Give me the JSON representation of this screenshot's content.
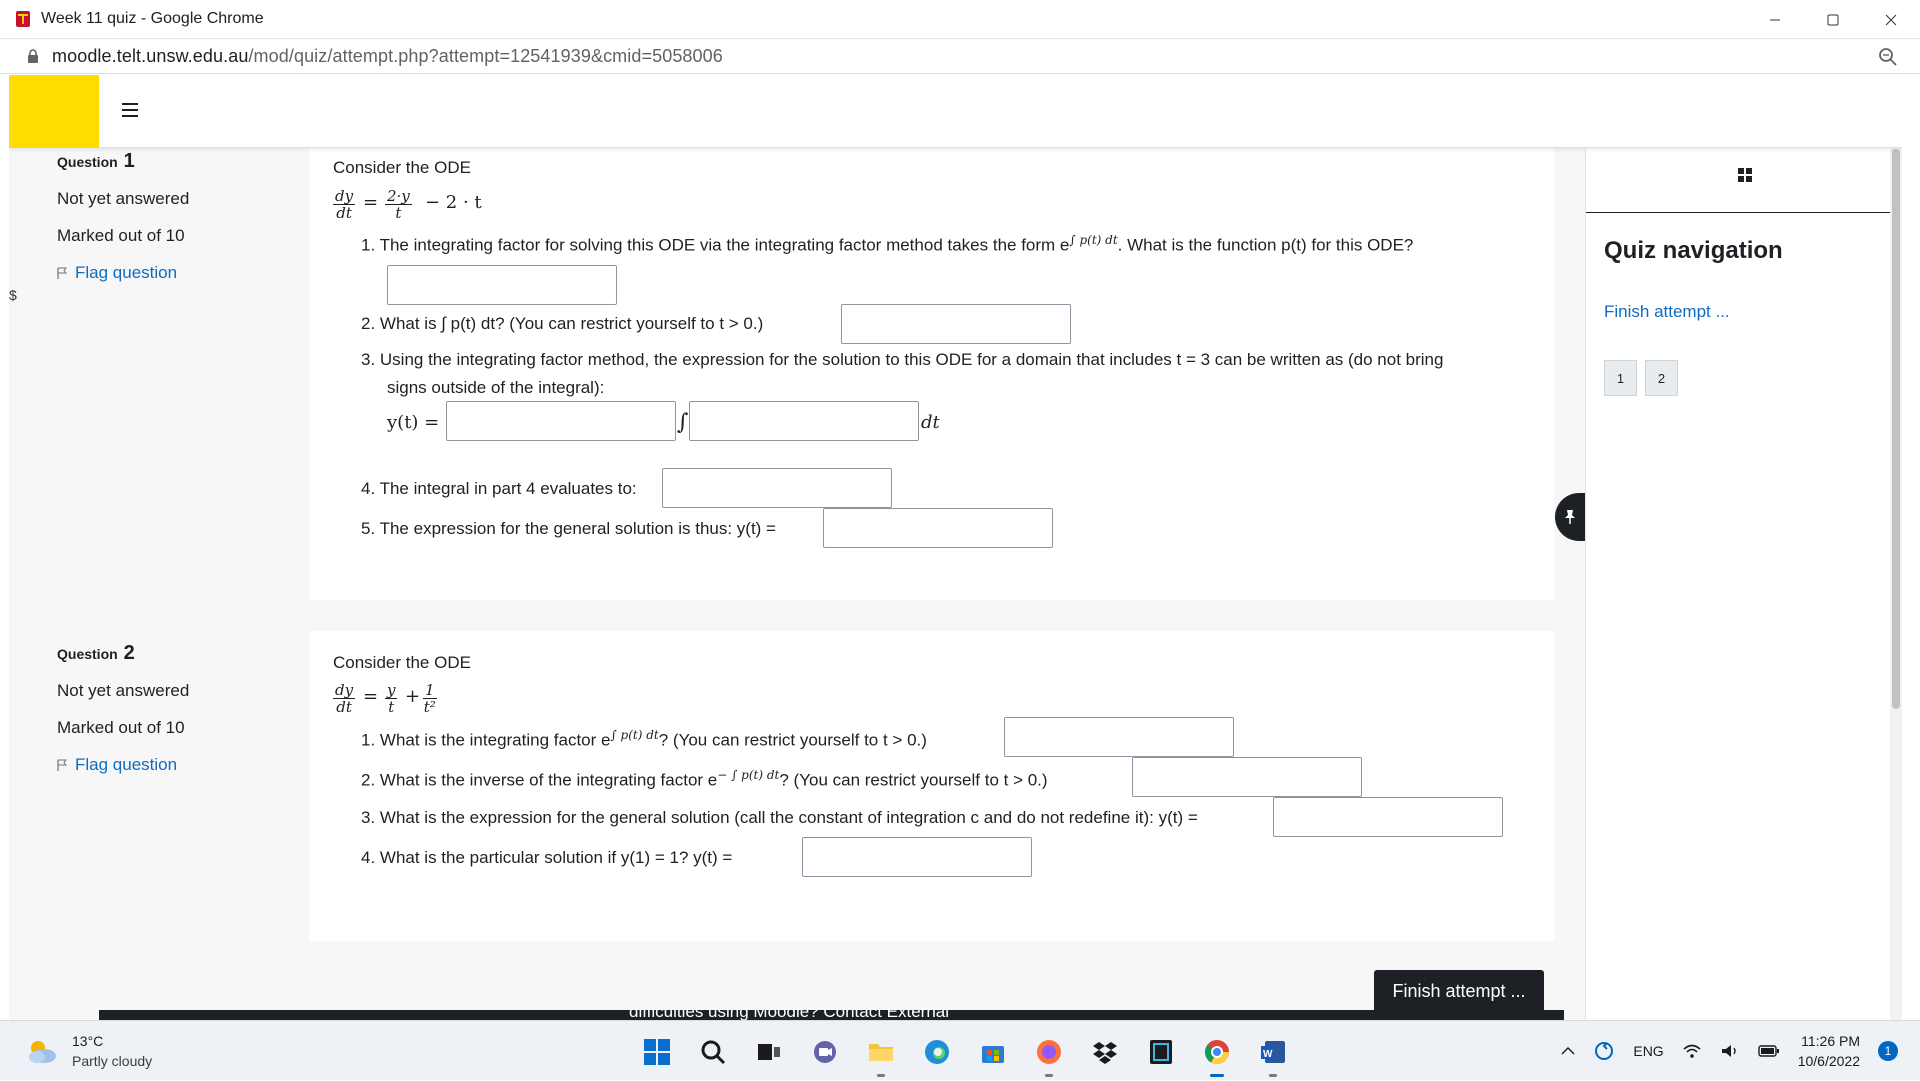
{
  "browser": {
    "window_title": "Week 11 quiz - Google Chrome",
    "url_host": "moodle.telt.unsw.edu.au",
    "url_path": "/mod/quiz/attempt.php?attempt=12541939&cmid=5058006",
    "minimize_icon": "minimize-icon",
    "maximize_icon": "maximize-icon",
    "close_icon": "close-icon"
  },
  "questions": [
    {
      "label": "Question",
      "number": "1",
      "state": "Not yet answered",
      "grade": "Marked out of 10",
      "flag_label": "Flag question",
      "intro": "Consider the ODE",
      "ode": {
        "lhs_num": "dy",
        "lhs_den": "dt",
        "rhs_frac_num": "2·y",
        "rhs_frac_den": "t",
        "rhs_rest": "− 2 · t"
      },
      "items": [
        {
          "text": "1. The integrating factor for solving this ODE via the integrating factor method takes the form e",
          "sup": "∫ p(t) dt",
          "after": ".  What is the function p(t) for this ODE?"
        },
        {
          "text": "2. What is ∫ p(t) dt? (You can restrict yourself to t > 0.)"
        },
        {
          "text": "3. Using the integrating factor method, the expression for the solution to this ODE for a domain that includes t = 3 can be written as (do not bring",
          "text2": "signs outside of the integral):",
          "solution_lhs": "y(t) =",
          "integral_sign": "∫",
          "dt_suffix": "dt"
        },
        {
          "text": "4. The integral in part 4 evaluates to:"
        },
        {
          "text": "5. The expression for the general solution is thus: y(t) ="
        }
      ]
    },
    {
      "label": "Question",
      "number": "2",
      "state": "Not yet answered",
      "grade": "Marked out of 10",
      "flag_label": "Flag question",
      "intro": "Consider the ODE",
      "ode": {
        "lhs_num": "dy",
        "lhs_den": "dt",
        "f1_num": "y",
        "f1_den": "t",
        "plus": "+",
        "f2_num": "1",
        "f2_den": "t²"
      },
      "items": [
        {
          "text": "1. What is the integrating factor e",
          "sup": "∫ p(t) dt",
          "after": "? (You can restrict yourself to t > 0.)"
        },
        {
          "text": "2. What is the inverse of the integrating factor e",
          "sup": "− ∫ p(t) dt",
          "after": "? (You can restrict yourself to t > 0.)"
        },
        {
          "text": "3. What is the expression for the general solution (call the constant of integration c and do not redefine it): y(t) ="
        },
        {
          "text": "4. What is the particular solution if y(1) = 1?  y(t) ="
        }
      ]
    }
  ],
  "drawer": {
    "title": "Quiz navigation",
    "finish_link": "Finish attempt ...",
    "question_buttons": [
      "1",
      "2"
    ]
  },
  "finish_button": "Finish attempt ...",
  "footer_text": "difficulties using Moodle? Contact External",
  "taskbar": {
    "temperature": "13°C",
    "condition": "Partly cloudy",
    "language": "ENG",
    "time": "11:26 PM",
    "date": "10/6/2022",
    "notification_count": "1"
  }
}
